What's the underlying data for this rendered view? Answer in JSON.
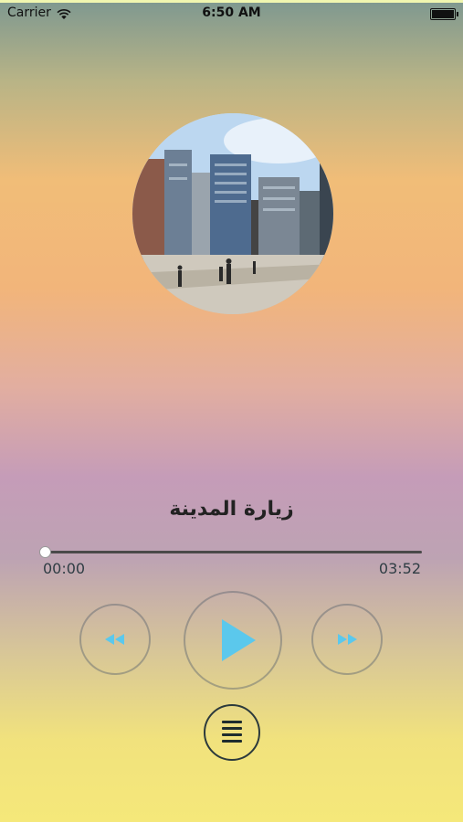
{
  "status_bar": {
    "carrier": "Carrier",
    "time": "6:50 AM"
  },
  "track": {
    "title": "زيارة المدينة",
    "elapsed": "00:00",
    "duration": "03:52",
    "progress_fraction": 0.0
  },
  "icons": {
    "wifi": "wifi-icon",
    "battery": "battery-icon",
    "rewind": "rewind-icon",
    "play": "play-icon",
    "forward": "fast-forward-icon",
    "menu": "hamburger-menu-icon"
  },
  "colors": {
    "accent": "#5bc8ec",
    "control_border": "#6b7580"
  }
}
